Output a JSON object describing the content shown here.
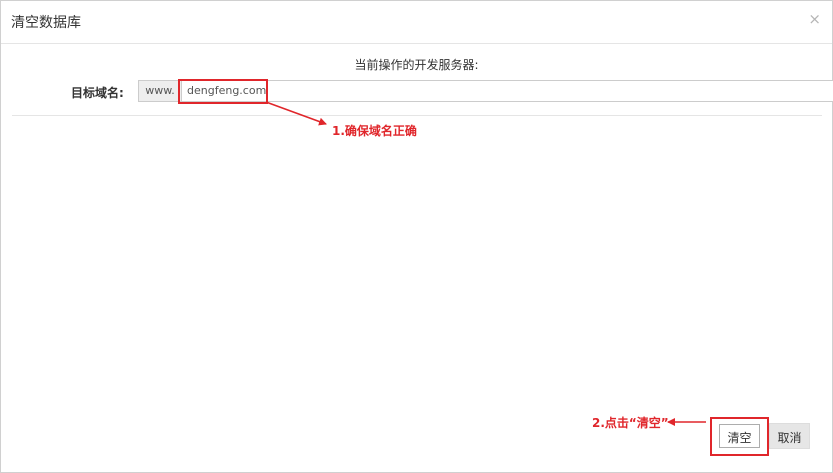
{
  "dialog": {
    "title": "清空数据库",
    "close_glyph": "×",
    "server_text": "当前操作的开发服务器:"
  },
  "form": {
    "domain_label": "目标域名:",
    "prefix": "www.",
    "domain_value": "dengfeng.com"
  },
  "annotations": {
    "step1": "1.确保域名正确",
    "step2": "2.点击“清空”",
    "color": "#e0262b"
  },
  "buttons": {
    "clear_label": "清空",
    "cancel_label": "取消"
  }
}
